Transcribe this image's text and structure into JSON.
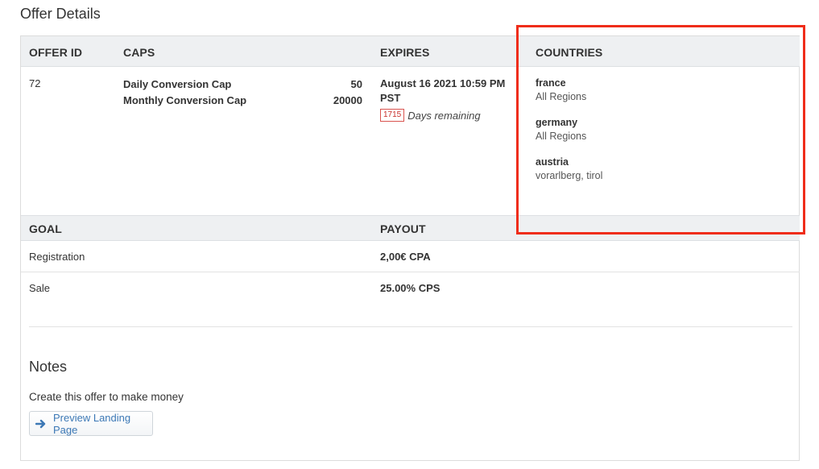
{
  "page": {
    "title": "Offer Details"
  },
  "offer_table": {
    "headers": {
      "offer_id": "OFFER ID",
      "caps": "CAPS",
      "expires": "EXPIRES",
      "countries": "COUNTRIES"
    },
    "offer_id": "72",
    "caps": [
      {
        "label": "Daily Conversion Cap",
        "value": "50"
      },
      {
        "label": "Monthly Conversion Cap",
        "value": "20000"
      }
    ],
    "expires": {
      "line1": "August 16 2021 10:59 PM",
      "line2": "PST",
      "days_count": "1715",
      "days_label": "Days remaining"
    },
    "countries": [
      {
        "name": "france",
        "regions": "All Regions"
      },
      {
        "name": "germany",
        "regions": "All Regions"
      },
      {
        "name": "austria",
        "regions": "vorarlberg, tirol"
      }
    ]
  },
  "goals_table": {
    "headers": {
      "goal": "GOAL",
      "payout": "PAYOUT"
    },
    "rows": [
      {
        "goal": "Registration",
        "payout": "2,00€ CPA"
      },
      {
        "goal": "Sale",
        "payout": "25.00% CPS"
      }
    ]
  },
  "notes": {
    "title": "Notes",
    "text": "Create this offer to make money",
    "preview_button": "Preview Landing Page"
  },
  "colors": {
    "highlight": "#ef2d1a",
    "link": "#3c78b5",
    "header_bg": "#eef0f2"
  },
  "icons": {
    "preview_button": "arrow-right-icon"
  }
}
